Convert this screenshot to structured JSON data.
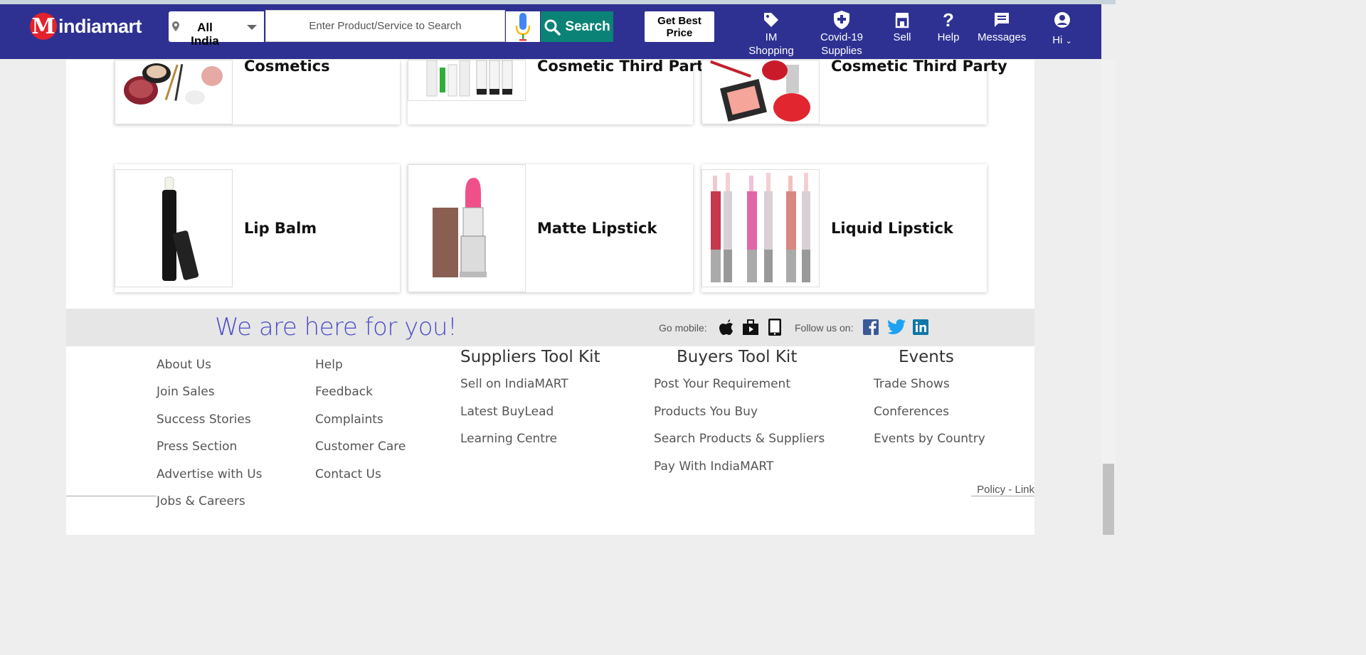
{
  "header": {
    "logo_letter": "M",
    "logo_text": "indiamart",
    "location": "All India",
    "search_placeholder": "Enter Product/Service to Search",
    "search_label": "Search",
    "best_price_label": "Get Best Price",
    "nav": [
      {
        "label": "IM Shopping",
        "icon": "tag-icon"
      },
      {
        "label": "Covid-19 Supplies",
        "icon": "shield-plus-icon"
      },
      {
        "label": "Sell",
        "icon": "store-icon"
      },
      {
        "label": "Help",
        "icon": "question-icon"
      },
      {
        "label": "Messages",
        "icon": "chat-icon"
      },
      {
        "label": "Hi",
        "icon": "user-icon"
      }
    ]
  },
  "products": [
    {
      "name": "Cosmetics"
    },
    {
      "name": "Cosmetic Third Party"
    },
    {
      "name": "Cosmetic Third Party"
    },
    {
      "name": "Lip Balm"
    },
    {
      "name": "Matte Lipstick"
    },
    {
      "name": "Liquid Lipstick"
    }
  ],
  "footer": {
    "tagline": "We are here for you!",
    "go_mobile": "Go mobile:",
    "follow_us": "Follow us on:",
    "col1": [
      "About Us",
      "Join Sales",
      "Success Stories",
      "Press Section",
      "Advertise with Us",
      "Jobs & Careers"
    ],
    "col2": [
      "Help",
      "Feedback",
      "Complaints",
      "Customer Care",
      "Contact Us"
    ],
    "suppliers_title": "Suppliers Tool Kit",
    "suppliers": [
      "Sell on IndiaMART",
      "Latest BuyLead",
      "Learning Centre"
    ],
    "buyers_title": "Buyers Tool Kit",
    "buyers": [
      "Post Your Requirement",
      "Products You Buy",
      "Search Products & Suppliers",
      "Pay With IndiaMART"
    ],
    "events_title": "Events",
    "events": [
      "Trade Shows",
      "Conferences",
      "Events by Country"
    ],
    "policy_link": "Policy - Link"
  },
  "colors": {
    "header_bg": "#2e3192",
    "search_btn": "#0b8276",
    "tagline": "#4c4ec7",
    "logo_red": "#e3222c"
  }
}
